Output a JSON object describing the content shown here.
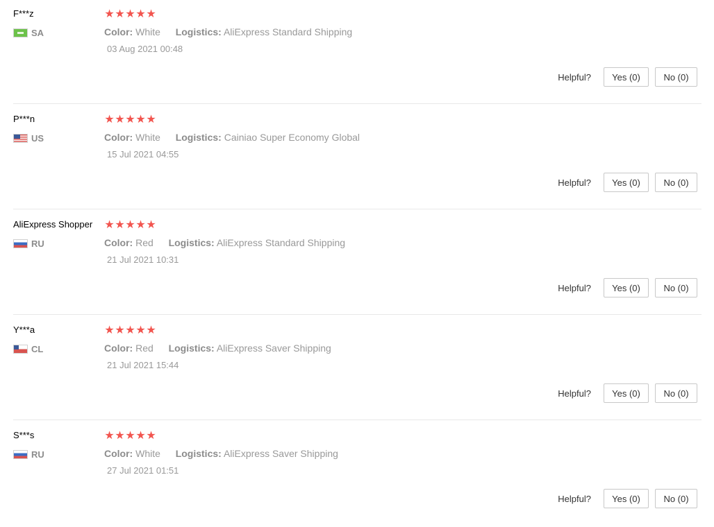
{
  "helpful_label": "Helpful?",
  "star_color": "#f2554f",
  "reviews": [
    {
      "user": "F***z",
      "country": "SA",
      "flag": "saudi-arabia-flag",
      "rating": 5,
      "color_label": "Color:",
      "color": "White",
      "logistics_label": "Logistics:",
      "logistics": "AliExpress Standard Shipping",
      "date": "03 Aug 2021 00:48",
      "yes": "Yes (0)",
      "no": "No (0)"
    },
    {
      "user": "P***n",
      "country": "US",
      "flag": "usa-flag",
      "rating": 5,
      "color_label": "Color:",
      "color": "White",
      "logistics_label": "Logistics:",
      "logistics": "Cainiao Super Economy Global",
      "date": "15 Jul 2021 04:55",
      "yes": "Yes (0)",
      "no": "No (0)"
    },
    {
      "user": "AliExpress Shopper",
      "country": "RU",
      "flag": "russia-flag",
      "rating": 5,
      "color_label": "Color:",
      "color": "Red",
      "logistics_label": "Logistics:",
      "logistics": "AliExpress Standard Shipping",
      "date": "21 Jul 2021 10:31",
      "yes": "Yes (0)",
      "no": "No (0)"
    },
    {
      "user": "Y***a",
      "country": "CL",
      "flag": "chile-flag",
      "rating": 5,
      "color_label": "Color:",
      "color": "Red",
      "logistics_label": "Logistics:",
      "logistics": "AliExpress Saver Shipping",
      "date": "21 Jul 2021 15:44",
      "yes": "Yes (0)",
      "no": "No (0)"
    },
    {
      "user": "S***s",
      "country": "RU",
      "flag": "russia-flag",
      "rating": 5,
      "color_label": "Color:",
      "color": "White",
      "logistics_label": "Logistics:",
      "logistics": "AliExpress Saver Shipping",
      "date": "27 Jul 2021 01:51",
      "yes": "Yes (0)",
      "no": "No (0)"
    }
  ]
}
